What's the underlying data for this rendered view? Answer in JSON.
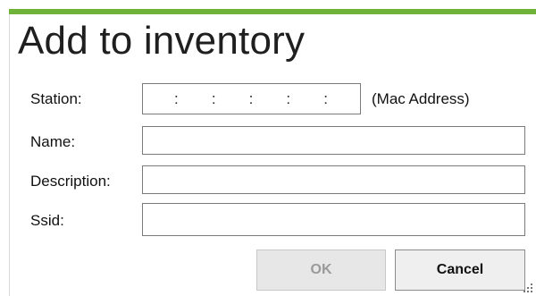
{
  "window": {
    "title": "Add to inventory",
    "accent_color": "#6fb33b"
  },
  "form": {
    "station_label": "Station:",
    "station_value": ":    :    :    :    :",
    "station_separators": [
      ":",
      ":",
      ":",
      ":",
      ":"
    ],
    "station_hint": "(Mac Address)",
    "name_label": "Name:",
    "name_value": "",
    "description_label": "Description:",
    "description_value": "",
    "ssid_label": "Ssid:",
    "ssid_value": ""
  },
  "buttons": {
    "ok_label": "OK",
    "ok_state": "disabled",
    "cancel_label": "Cancel"
  },
  "icons": {
    "resize_grip": "resize-grip-icon"
  }
}
